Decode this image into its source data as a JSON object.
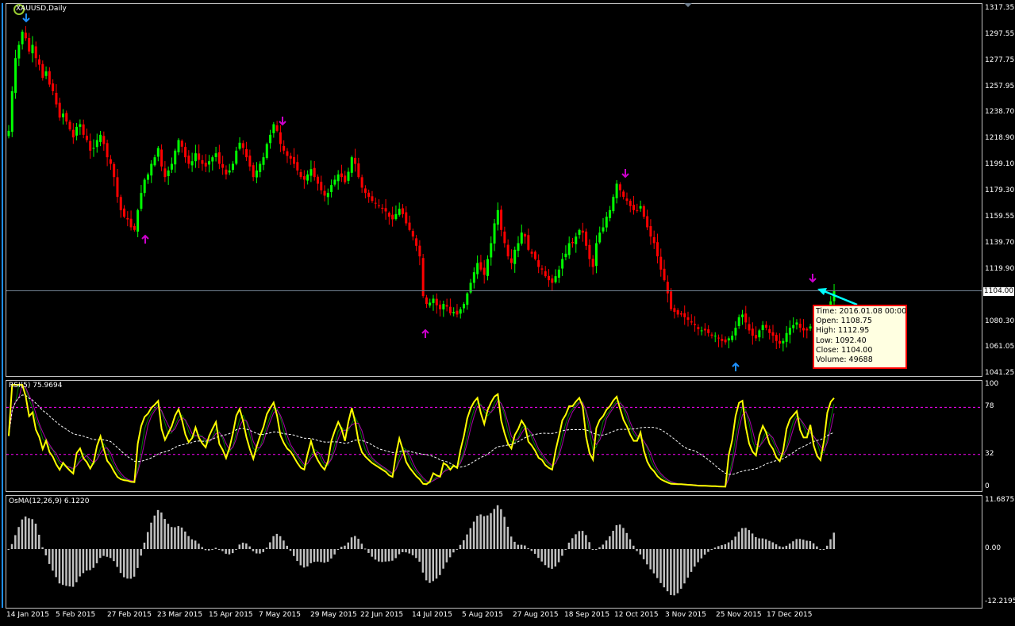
{
  "window": {
    "title": "XAUUSD,Daily"
  },
  "colors": {
    "background": "#000000",
    "bull": "#00ff00",
    "bear": "#ff0000",
    "frame": "#c0c0c0",
    "rsi": "#ffff00",
    "rsi_levels": "#ff00ff",
    "osma": "#c0c0c0",
    "arrow_up_low": "#1e90ff",
    "arrow_magenta": "#cc00cc",
    "cursor_arrow": "#00ffff",
    "price_line": "#708090"
  },
  "price_axis": [
    "1317.35",
    "1297.55",
    "1277.75",
    "1257.95",
    "1238.70",
    "1218.90",
    "1199.10",
    "1179.30",
    "1159.55",
    "1139.70",
    "1119.90",
    "1080.30",
    "1061.05",
    "1041.25"
  ],
  "current_price_label": "1104.00",
  "time_axis": [
    "14 Jan 2015",
    "5 Feb 2015",
    "27 Feb 2015",
    "23 Mar 2015",
    "15 Apr 2015",
    "7 May 2015",
    "29 May 2015",
    "22 Jun 2015",
    "14 Jul 2015",
    "5 Aug 2015",
    "27 Aug 2015",
    "18 Sep 2015",
    "12 Oct 2015",
    "3 Nov 2015",
    "25 Nov 2015",
    "17 Dec 2015"
  ],
  "tooltip": {
    "time": "Time: 2016.01.08 00:00",
    "open": "Open: 1108.75",
    "high": "High: 1112.95",
    "low": "Low:  1092.40",
    "close": "Close: 1104.00",
    "volume": "Volume: 49688"
  },
  "rsi": {
    "label": "RSI(5) 75.9694",
    "axis": [
      "100",
      "78",
      "32",
      "0"
    ],
    "levels": [
      78,
      32
    ]
  },
  "osma": {
    "label": "OsMA(12,26,9) 6.1220",
    "axis": [
      "11.6875",
      "0.00",
      "-12.2195"
    ]
  },
  "chart_data": {
    "type": "candlestick",
    "symbol": "XAUUSD",
    "timeframe": "Daily",
    "ylim": [
      1041.25,
      1317.35
    ],
    "close_series": [
      1225,
      1255,
      1280,
      1290,
      1300,
      1295,
      1285,
      1290,
      1280,
      1275,
      1265,
      1270,
      1260,
      1255,
      1245,
      1235,
      1238,
      1232,
      1226,
      1220,
      1228,
      1230,
      1222,
      1218,
      1210,
      1212,
      1218,
      1222,
      1215,
      1205,
      1200,
      1190,
      1175,
      1165,
      1160,
      1158,
      1152,
      1150,
      1165,
      1178,
      1188,
      1192,
      1200,
      1205,
      1212,
      1198,
      1190,
      1195,
      1200,
      1210,
      1218,
      1213,
      1205,
      1200,
      1202,
      1208,
      1203,
      1200,
      1198,
      1202,
      1205,
      1208,
      1200,
      1197,
      1192,
      1195,
      1200,
      1210,
      1216,
      1212,
      1205,
      1198,
      1190,
      1195,
      1200,
      1205,
      1215,
      1222,
      1230,
      1225,
      1215,
      1210,
      1206,
      1204,
      1200,
      1195,
      1190,
      1188,
      1192,
      1196,
      1190,
      1185,
      1180,
      1176,
      1178,
      1184,
      1188,
      1192,
      1190,
      1186,
      1194,
      1205,
      1200,
      1190,
      1182,
      1178,
      1175,
      1172,
      1170,
      1168,
      1166,
      1164,
      1160,
      1158,
      1162,
      1166,
      1162,
      1155,
      1150,
      1145,
      1138,
      1130,
      1100,
      1094,
      1095,
      1098,
      1093,
      1090,
      1094,
      1092,
      1087,
      1088,
      1086,
      1090,
      1094,
      1102,
      1110,
      1118,
      1125,
      1120,
      1116,
      1128,
      1140,
      1155,
      1165,
      1150,
      1140,
      1130,
      1125,
      1135,
      1140,
      1148,
      1145,
      1135,
      1132,
      1128,
      1122,
      1120,
      1115,
      1112,
      1110,
      1115,
      1120,
      1128,
      1132,
      1140,
      1140,
      1145,
      1150,
      1148,
      1138,
      1128,
      1122,
      1140,
      1148,
      1152,
      1160,
      1165,
      1175,
      1185,
      1180,
      1175,
      1172,
      1168,
      1165,
      1165,
      1168,
      1160,
      1152,
      1145,
      1140,
      1130,
      1120,
      1112,
      1102,
      1090,
      1088,
      1086,
      1086,
      1084,
      1082,
      1080,
      1078,
      1075,
      1074,
      1074,
      1072,
      1070,
      1070,
      1068,
      1066,
      1065,
      1068,
      1070,
      1076,
      1084,
      1086,
      1080,
      1074,
      1070,
      1068,
      1074,
      1078,
      1076,
      1072,
      1070,
      1066,
      1064,
      1066,
      1072,
      1076,
      1078,
      1080,
      1076,
      1074,
      1074,
      1077,
      1072,
      1068,
      1066,
      1070,
      1083,
      1096,
      1104
    ]
  }
}
